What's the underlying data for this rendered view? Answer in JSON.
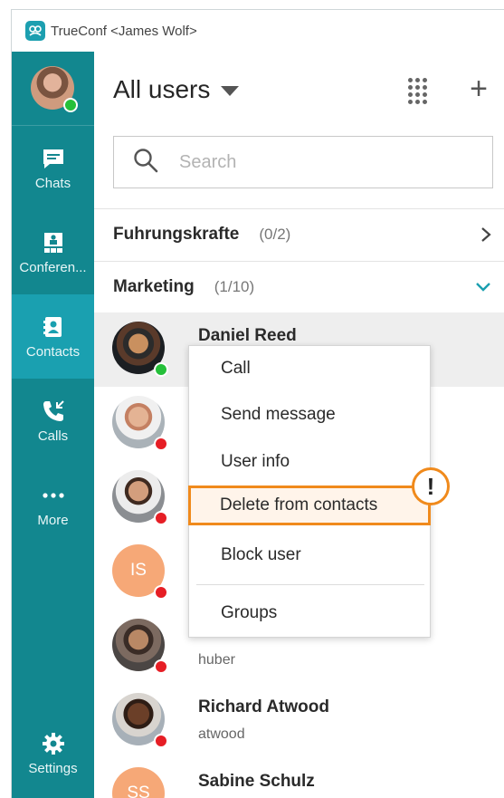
{
  "window": {
    "title": "TrueConf <James Wolf>"
  },
  "sidebar": {
    "user_status": "online",
    "items": [
      {
        "label": "Chats",
        "icon": "chat-icon"
      },
      {
        "label": "Conferen...",
        "icon": "conference-icon"
      },
      {
        "label": "Contacts",
        "icon": "contacts-icon",
        "active": true
      },
      {
        "label": "Calls",
        "icon": "calls-icon"
      },
      {
        "label": "More",
        "icon": "more-icon"
      },
      {
        "label": "Settings",
        "icon": "gear-icon"
      }
    ]
  },
  "header": {
    "title": "All users"
  },
  "search": {
    "placeholder": "Search"
  },
  "groups": [
    {
      "name": "Fuhrungskrafte",
      "count": "(0/2)",
      "expanded": false
    },
    {
      "name": "Marketing",
      "count": "(1/10)",
      "expanded": true
    }
  ],
  "contacts": [
    {
      "name": "Daniel Reed",
      "login": "",
      "status": "online"
    },
    {
      "name": "",
      "login": "",
      "status": "offline"
    },
    {
      "name": "",
      "login": "",
      "status": "offline"
    },
    {
      "name": "",
      "login": "",
      "initials": "IS",
      "status": "offline"
    },
    {
      "name": "",
      "login": "huber",
      "status": "offline"
    },
    {
      "name": "Richard Atwood",
      "login": "atwood",
      "status": "offline"
    },
    {
      "name": "Sabine Schulz",
      "login": "",
      "initials": "SS",
      "status": "offline"
    }
  ],
  "context_menu": {
    "items": [
      "Call",
      "Send message",
      "User info",
      "Delete from contacts",
      "Block user",
      "Groups"
    ],
    "highlighted": "Delete from contacts",
    "badge": "!"
  },
  "colors": {
    "sidebar": "#12878f",
    "sidebar_active": "#1aa0b0",
    "accent": "#1a9fb0",
    "highlight": "#f08a1c",
    "online": "#25c03a",
    "offline": "#e61e25",
    "initials_avatar": "#f6a877"
  }
}
